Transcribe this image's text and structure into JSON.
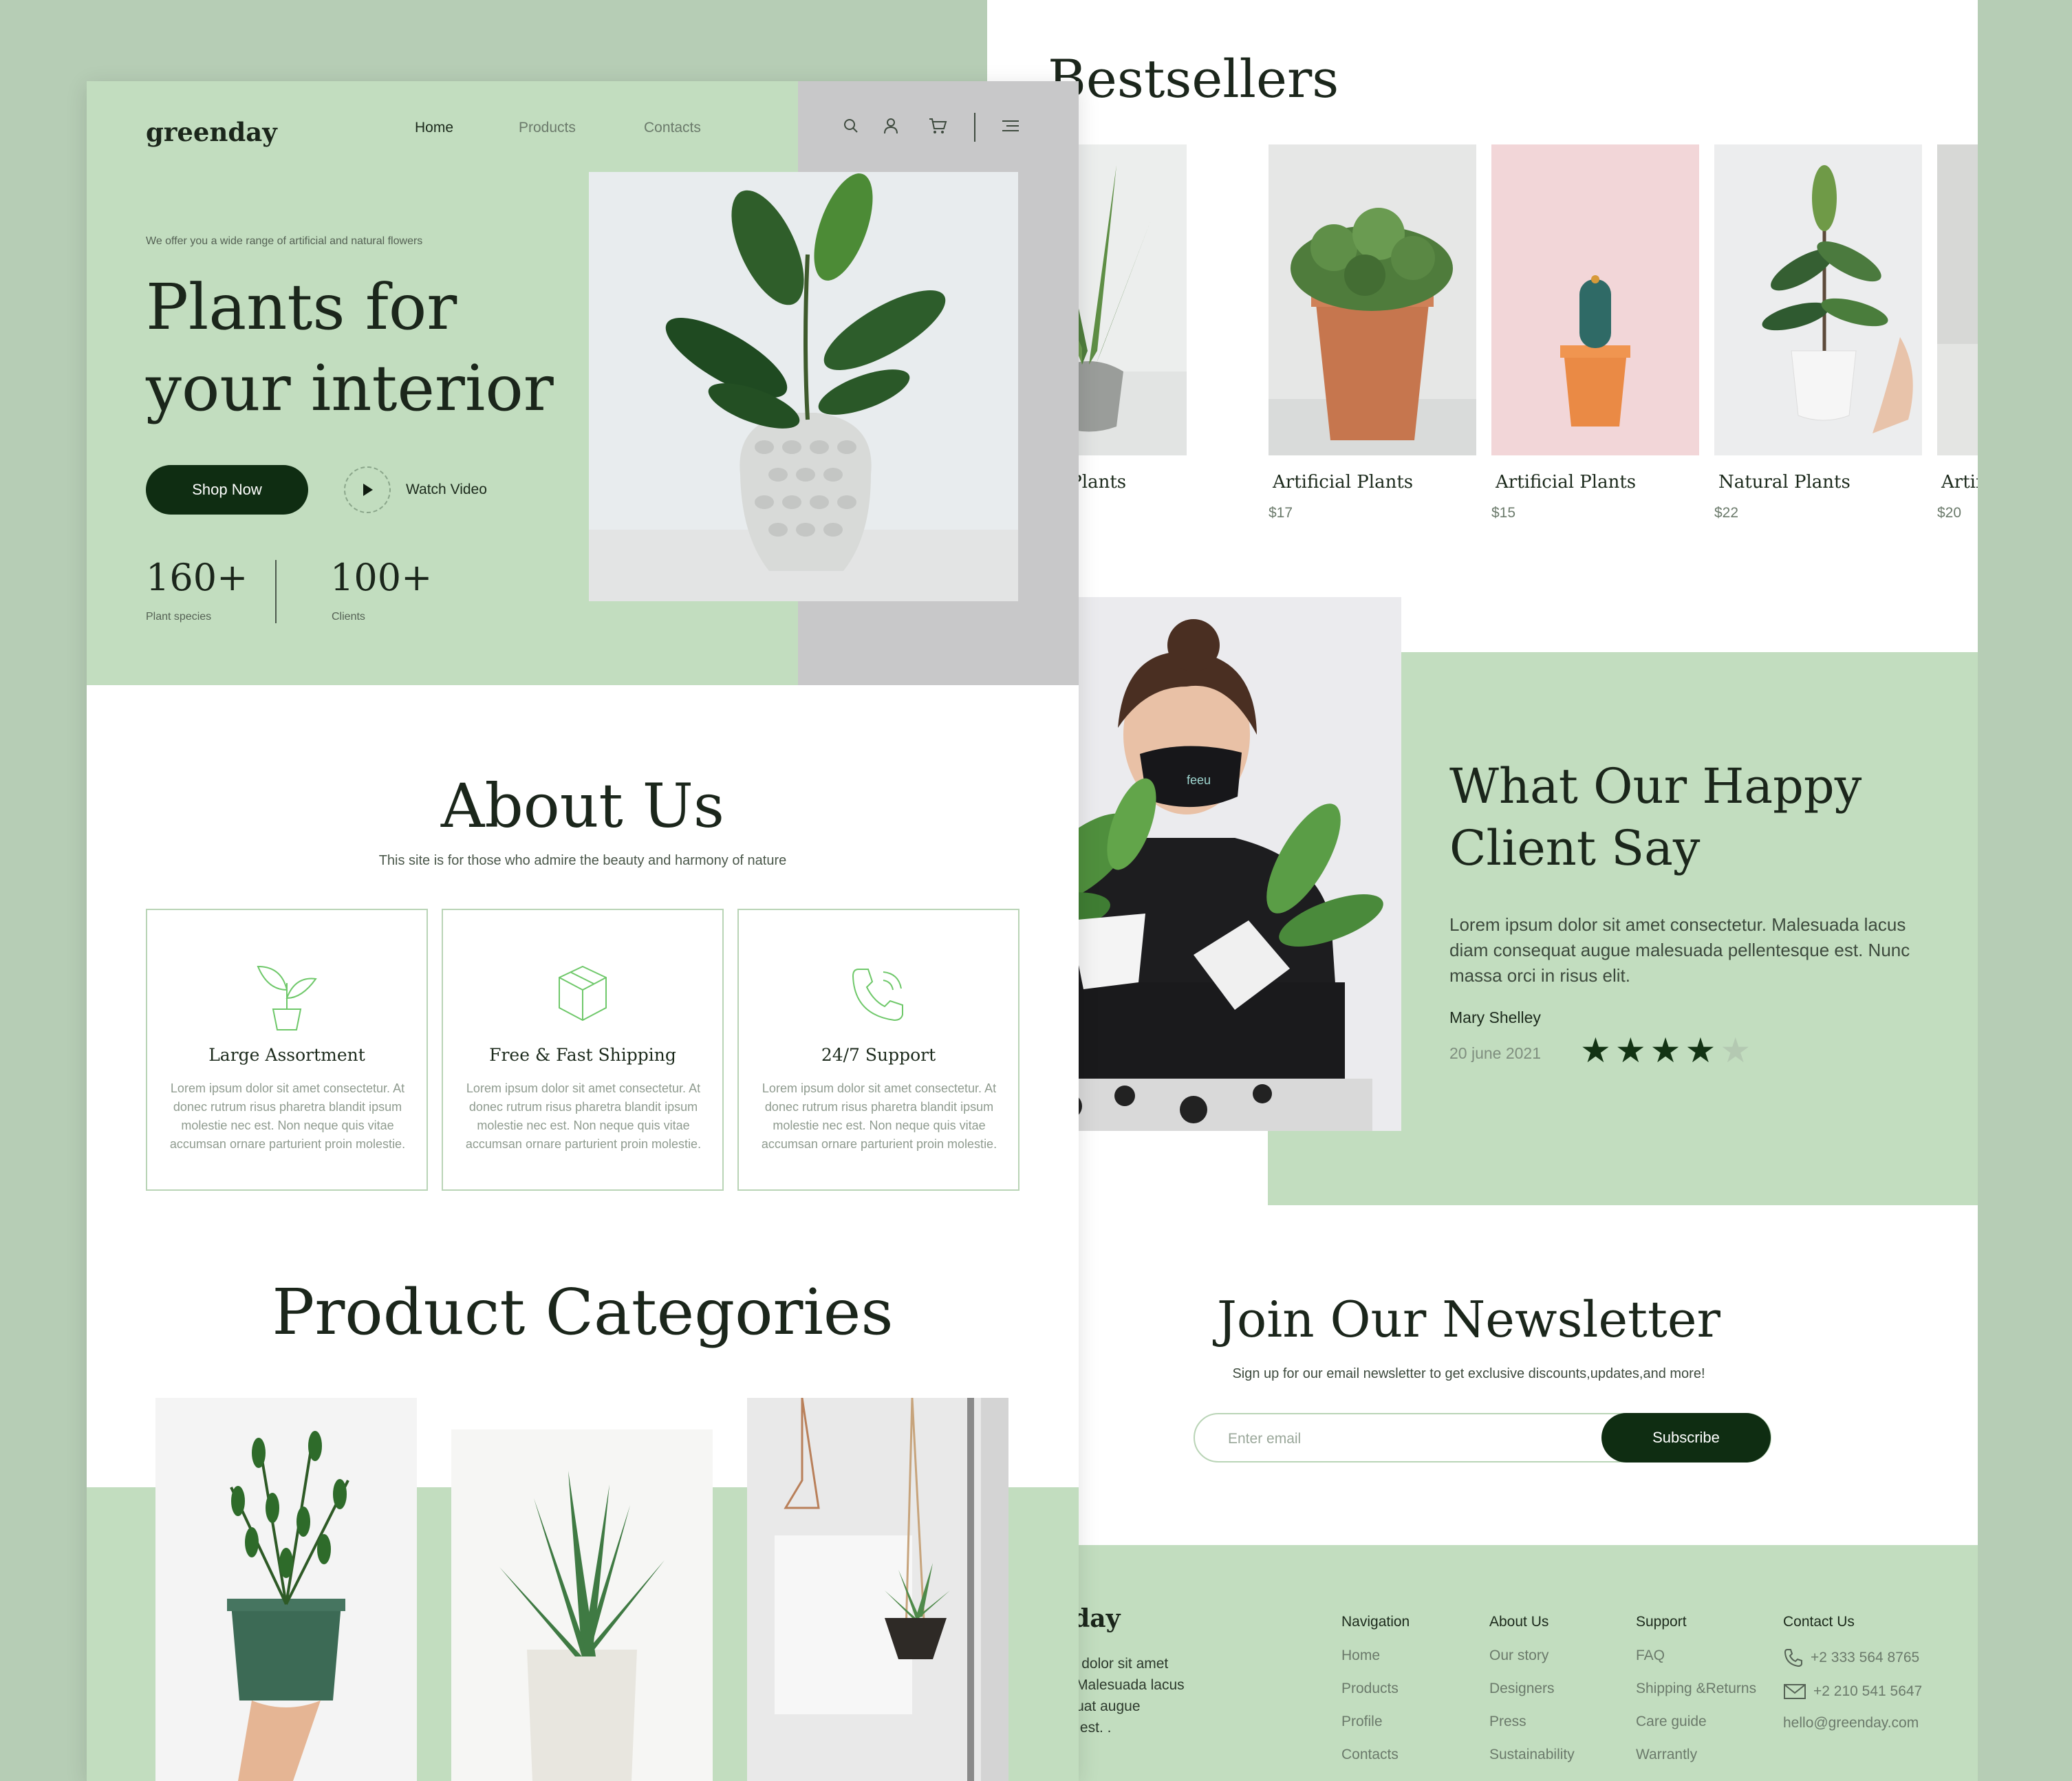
{
  "right": {
    "bestsellers_title": "Bestsellers",
    "products": [
      {
        "name": "Artificial Plants",
        "price": ""
      },
      {
        "name": "Artificial Plants",
        "price": "$17"
      },
      {
        "name": "Artificial Plants",
        "price": "$15"
      },
      {
        "name": "Natural Plants",
        "price": "$22"
      },
      {
        "name": "Artificial Plants",
        "price": "$20"
      }
    ],
    "testimonial": {
      "title": "What Our Happy Client Say",
      "text": "Lorem ipsum dolor sit amet consectetur. Malesuada lacus diam consequat augue malesuada pellentesque est. Nunc massa orci in risus elit.",
      "author": "Mary Shelley",
      "date": "20 june 2021",
      "rating": 4,
      "rating_max": 5,
      "mask_text": "feeu"
    },
    "newsletter": {
      "title": "Join Our Newsletter",
      "subtitle": "Sign up for our email newsletter to get exclusive discounts,updates,and more!",
      "placeholder": "Enter email",
      "button": "Subscribe"
    },
    "footer": {
      "logo": "greenday",
      "about": "Lorem ipsum dolor sit amet consectetur. Malesuada lacus diam consequat augue pellentesque est. .",
      "columns": [
        {
          "heading": "Navigation",
          "items": [
            "Home",
            "Products",
            "Profile",
            "Contacts"
          ]
        },
        {
          "heading": "About Us",
          "items": [
            "Our story",
            "Designers",
            "Press",
            "Sustainability"
          ]
        },
        {
          "heading": "Support",
          "items": [
            "FAQ",
            "Shipping &Returns",
            "Care guide",
            "Warrantly"
          ]
        }
      ],
      "contact": {
        "heading": "Contact Us",
        "phone1": "+2 333 564 8765",
        "phone2": "+2 210 541 5647",
        "email": "hello@greenday.com"
      },
      "social_icons": [
        "twitter-icon",
        "instagram-icon"
      ]
    }
  },
  "left": {
    "logo": "greenday",
    "nav": {
      "home": "Home",
      "products": "Products",
      "contacts": "Contacts"
    },
    "nav_icons": [
      "search-icon",
      "user-icon",
      "cart-icon",
      "menu-icon"
    ],
    "hero": {
      "tagline": "We offer you a wide range of artificial and natural flowers",
      "title_line1": "Plants for",
      "title_line2": "your interior",
      "shop_now": "Shop Now",
      "watch_video": "Watch Video",
      "stats": [
        {
          "value": "160+",
          "label": "Plant species"
        },
        {
          "value": "100+",
          "label": "Clients"
        }
      ]
    },
    "about": {
      "title": "About Us",
      "subtitle": "This site is for those who admire the beauty and harmony of nature",
      "features": [
        {
          "icon": "sprout-icon",
          "title": "Large Assortment",
          "text": "Lorem ipsum dolor sit amet consectetur. At donec rutrum risus pharetra blandit ipsum molestie nec est. Non neque quis vitae accumsan ornare parturient proin molestie."
        },
        {
          "icon": "box-icon",
          "title": "Free & Fast Shipping",
          "text": "Lorem ipsum dolor sit amet consectetur. At donec rutrum risus pharetra blandit ipsum molestie nec est. Non neque quis vitae accumsan ornare parturient proin molestie."
        },
        {
          "icon": "phone-icon",
          "title": "24/7 Support",
          "text": "Lorem ipsum dolor sit amet consectetur. At donec rutrum risus pharetra blandit ipsum molestie nec est. Non neque quis vitae accumsan ornare parturient proin molestie."
        }
      ]
    },
    "categories_title": "Product Categories"
  },
  "colors": {
    "page_bg": "#b6cdb5",
    "mint": "#c2ddbf",
    "dark_green": "#0f2d12",
    "grey_panel": "#c8c8c9",
    "text_dark": "#1b261b"
  }
}
